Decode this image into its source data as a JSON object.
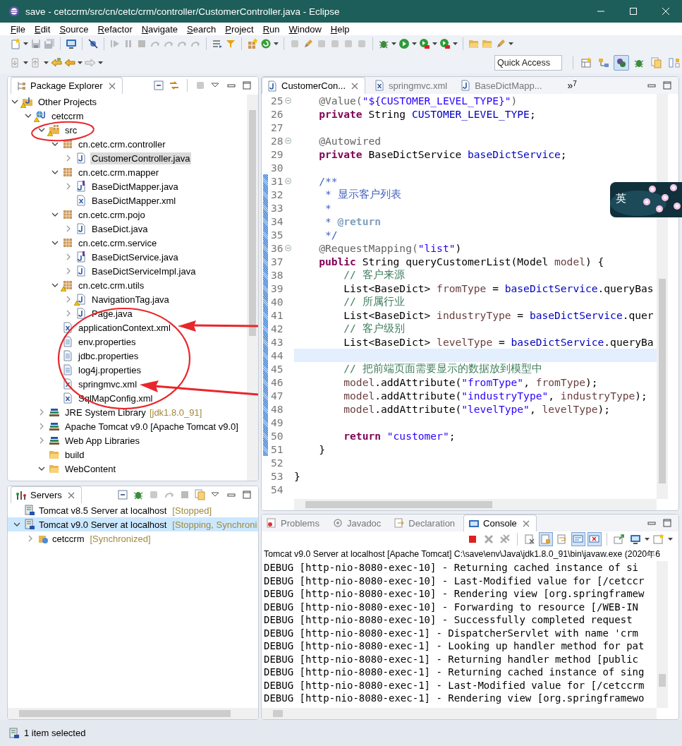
{
  "window": {
    "title": "save - cetccrm/src/cn/cetc/crm/controller/CustomerController.java - Eclipse"
  },
  "menu": [
    "File",
    "Edit",
    "Source",
    "Refactor",
    "Navigate",
    "Search",
    "Project",
    "Run",
    "Window",
    "Help"
  ],
  "quick_access": {
    "placeholder": "Quick Access"
  },
  "perspectives": [
    {
      "selected": false
    },
    {
      "selected": false
    },
    {
      "selected": true
    },
    {
      "selected": false
    },
    {
      "selected": false
    },
    {
      "selected": false
    }
  ],
  "package_explorer": {
    "title": "Package Explorer",
    "tree": [
      {
        "label": "Other Projects",
        "kind": "working-set",
        "expanded": true,
        "selected": false,
        "warning": true,
        "children": [
          {
            "label": "cetccrm",
            "kind": "project",
            "expanded": true,
            "selected": false,
            "warning": true,
            "children": [
              {
                "label": "src",
                "kind": "source-folder",
                "expanded": true,
                "selected": false,
                "warning": true,
                "children": [
                  {
                    "label": "cn.cetc.crm.controller",
                    "kind": "package",
                    "expanded": true,
                    "selected": false,
                    "warning": false,
                    "children": [
                      {
                        "label": "CustomerController.java",
                        "kind": "java",
                        "expanded": false,
                        "selected": true,
                        "warning": false
                      }
                    ]
                  },
                  {
                    "label": "cn.cetc.crm.mapper",
                    "kind": "package",
                    "expanded": true,
                    "selected": false,
                    "warning": false,
                    "children": [
                      {
                        "label": "BaseDictMapper.java",
                        "kind": "interface",
                        "expanded": false,
                        "selected": false,
                        "warning": false
                      },
                      {
                        "label": "BaseDictMapper.xml",
                        "kind": "xml",
                        "selected": false,
                        "warning": false
                      }
                    ]
                  },
                  {
                    "label": "cn.cetc.crm.pojo",
                    "kind": "package",
                    "expanded": true,
                    "selected": false,
                    "warning": false,
                    "children": [
                      {
                        "label": "BaseDict.java",
                        "kind": "java",
                        "expanded": false,
                        "selected": false,
                        "warning": false
                      }
                    ]
                  },
                  {
                    "label": "cn.cetc.crm.service",
                    "kind": "package",
                    "expanded": true,
                    "selected": false,
                    "warning": false,
                    "children": [
                      {
                        "label": "BaseDictService.java",
                        "kind": "interface",
                        "expanded": false,
                        "selected": false,
                        "warning": false
                      },
                      {
                        "label": "BaseDictServiceImpl.java",
                        "kind": "java",
                        "expanded": false,
                        "selected": false,
                        "warning": false
                      }
                    ]
                  },
                  {
                    "label": "cn.cetc.crm.utils",
                    "kind": "package",
                    "expanded": true,
                    "selected": false,
                    "warning": true,
                    "children": [
                      {
                        "label": "NavigationTag.java",
                        "kind": "java",
                        "expanded": false,
                        "selected": false,
                        "warning": true
                      },
                      {
                        "label": "Page.java",
                        "kind": "java",
                        "expanded": false,
                        "selected": false,
                        "warning": false
                      }
                    ]
                  },
                  {
                    "label": "applicationContext.xml",
                    "kind": "xml",
                    "selected": false,
                    "warning": false
                  },
                  {
                    "label": "env.properties",
                    "kind": "properties",
                    "selected": false,
                    "warning": false
                  },
                  {
                    "label": "jdbc.properties",
                    "kind": "properties",
                    "selected": false,
                    "warning": false
                  },
                  {
                    "label": "log4j.properties",
                    "kind": "properties",
                    "selected": false,
                    "warning": false
                  },
                  {
                    "label": "springmvc.xml",
                    "kind": "xml",
                    "selected": false,
                    "warning": false
                  },
                  {
                    "label": "SqlMapConfig.xml",
                    "kind": "xml",
                    "selected": false,
                    "warning": false
                  }
                ]
              },
              {
                "label": "JRE System Library",
                "decoration": "[jdk1.8.0_91]",
                "kind": "library",
                "expanded": false,
                "selected": false,
                "warning": false
              },
              {
                "label": "Apache Tomcat v9.0 [Apache Tomcat v9.0]",
                "kind": "library",
                "expanded": false,
                "selected": false,
                "warning": false
              },
              {
                "label": "Web App Libraries",
                "kind": "library",
                "expanded": false,
                "selected": false,
                "warning": false
              },
              {
                "label": "build",
                "kind": "folder",
                "selected": false,
                "warning": false
              },
              {
                "label": "WebContent",
                "kind": "folder",
                "expanded": true,
                "selected": false,
                "warning": false
              }
            ]
          }
        ]
      }
    ]
  },
  "editor": {
    "tabs": [
      {
        "label": "CustomerCon...",
        "kind": "java",
        "selected": true
      },
      {
        "label": "springmvc.xml",
        "kind": "xml",
        "selected": false
      },
      {
        "label": "BaseDictMapp...",
        "kind": "java",
        "selected": false
      }
    ],
    "overflow": {
      "symbol": "»",
      "count": "7"
    },
    "lines": [
      {
        "n": "25",
        "fold": true,
        "changed": false,
        "current": false,
        "tokens": [
          {
            "kind": "ann",
            "text": "    @Value("
          },
          {
            "kind": "str",
            "text": "\"${CUSTOMER_LEVEL_TYPE}\""
          },
          {
            "kind": "ann",
            "text": ")"
          }
        ]
      },
      {
        "n": "26",
        "fold": false,
        "changed": false,
        "current": false,
        "tokens": [
          {
            "kind": "kw",
            "text": "    private"
          },
          {
            "kind": "plain",
            "text": " String "
          },
          {
            "kind": "field",
            "text": "CUSTOMER_LEVEL_TYPE"
          },
          {
            "kind": "plain",
            "text": ";"
          }
        ]
      },
      {
        "n": "27",
        "fold": false,
        "changed": false,
        "current": false
      },
      {
        "n": "28",
        "fold": true,
        "changed": false,
        "current": false,
        "tokens": [
          {
            "kind": "ann",
            "text": "    @Autowired"
          }
        ]
      },
      {
        "n": "29",
        "fold": false,
        "changed": false,
        "current": false,
        "tokens": [
          {
            "kind": "kw",
            "text": "    private"
          },
          {
            "kind": "plain",
            "text": " BaseDictService "
          },
          {
            "kind": "field",
            "text": "baseDictService"
          },
          {
            "kind": "plain",
            "text": ";"
          }
        ]
      },
      {
        "n": "30",
        "fold": false,
        "changed": false,
        "current": false
      },
      {
        "n": "31",
        "fold": true,
        "changed": true,
        "current": false,
        "tokens": [
          {
            "kind": "doc",
            "text": "    /**"
          }
        ]
      },
      {
        "n": "32",
        "fold": false,
        "changed": true,
        "current": false,
        "tokens": [
          {
            "kind": "doc",
            "text": "     * 显示客户列表"
          }
        ]
      },
      {
        "n": "33",
        "fold": false,
        "changed": true,
        "current": false,
        "tokens": [
          {
            "kind": "doc",
            "text": "     *"
          }
        ]
      },
      {
        "n": "34",
        "fold": false,
        "changed": true,
        "current": false,
        "tokens": [
          {
            "kind": "doc",
            "text": "     * "
          },
          {
            "kind": "doctag",
            "text": "@return"
          }
        ]
      },
      {
        "n": "35",
        "fold": false,
        "changed": true,
        "current": false,
        "tokens": [
          {
            "kind": "doc",
            "text": "     */"
          }
        ]
      },
      {
        "n": "36",
        "fold": true,
        "changed": true,
        "current": false,
        "tokens": [
          {
            "kind": "ann",
            "text": "    @RequestMapping("
          },
          {
            "kind": "str",
            "text": "\"list\""
          },
          {
            "kind": "plain",
            "text": ")"
          }
        ]
      },
      {
        "n": "37",
        "fold": false,
        "changed": true,
        "current": false,
        "tokens": [
          {
            "kind": "kw",
            "text": "    public"
          },
          {
            "kind": "plain",
            "text": " String queryCustomerList(Model "
          },
          {
            "kind": "local",
            "text": "model"
          },
          {
            "kind": "plain",
            "text": ") {"
          }
        ]
      },
      {
        "n": "38",
        "fold": false,
        "changed": true,
        "current": false,
        "tokens": [
          {
            "kind": "comment",
            "text": "        // 客户来源"
          }
        ]
      },
      {
        "n": "39",
        "fold": false,
        "changed": true,
        "current": false,
        "tokens": [
          {
            "kind": "plain",
            "text": "        List<BaseDict> "
          },
          {
            "kind": "local",
            "text": "fromType"
          },
          {
            "kind": "plain",
            "text": " = "
          },
          {
            "kind": "field",
            "text": "baseDictService"
          },
          {
            "kind": "plain",
            "text": ".queryBas"
          }
        ]
      },
      {
        "n": "40",
        "fold": false,
        "changed": true,
        "current": false,
        "tokens": [
          {
            "kind": "comment",
            "text": "        // 所属行业"
          }
        ]
      },
      {
        "n": "41",
        "fold": false,
        "changed": true,
        "current": false,
        "tokens": [
          {
            "kind": "plain",
            "text": "        List<BaseDict> "
          },
          {
            "kind": "local",
            "text": "industryType"
          },
          {
            "kind": "plain",
            "text": " = "
          },
          {
            "kind": "field",
            "text": "baseDictService"
          },
          {
            "kind": "plain",
            "text": ".quer"
          }
        ]
      },
      {
        "n": "42",
        "fold": false,
        "changed": true,
        "current": false,
        "tokens": [
          {
            "kind": "comment",
            "text": "        // 客户级别"
          }
        ]
      },
      {
        "n": "43",
        "fold": false,
        "changed": true,
        "current": false,
        "tokens": [
          {
            "kind": "plain",
            "text": "        List<BaseDict> "
          },
          {
            "kind": "local",
            "text": "levelType"
          },
          {
            "kind": "plain",
            "text": " = "
          },
          {
            "kind": "field",
            "text": "baseDictService"
          },
          {
            "kind": "plain",
            "text": ".queryBa"
          }
        ]
      },
      {
        "n": "44",
        "fold": false,
        "changed": true,
        "current": true
      },
      {
        "n": "45",
        "fold": false,
        "changed": true,
        "current": false,
        "tokens": [
          {
            "kind": "comment",
            "text": "        // 把前端页面需要显示的数据放到模型中"
          }
        ]
      },
      {
        "n": "46",
        "fold": false,
        "changed": true,
        "current": false,
        "tokens": [
          {
            "kind": "local",
            "text": "        model"
          },
          {
            "kind": "plain",
            "text": ".addAttribute("
          },
          {
            "kind": "str",
            "text": "\"fromType\""
          },
          {
            "kind": "plain",
            "text": ", "
          },
          {
            "kind": "local",
            "text": "fromType"
          },
          {
            "kind": "plain",
            "text": ");"
          }
        ]
      },
      {
        "n": "47",
        "fold": false,
        "changed": true,
        "current": false,
        "tokens": [
          {
            "kind": "local",
            "text": "        model"
          },
          {
            "kind": "plain",
            "text": ".addAttribute("
          },
          {
            "kind": "str",
            "text": "\"industryType\""
          },
          {
            "kind": "plain",
            "text": ", "
          },
          {
            "kind": "local",
            "text": "industryType"
          },
          {
            "kind": "plain",
            "text": ");"
          }
        ]
      },
      {
        "n": "48",
        "fold": false,
        "changed": true,
        "current": false,
        "tokens": [
          {
            "kind": "local",
            "text": "        model"
          },
          {
            "kind": "plain",
            "text": ".addAttribute("
          },
          {
            "kind": "str",
            "text": "\"levelType\""
          },
          {
            "kind": "plain",
            "text": ", "
          },
          {
            "kind": "local",
            "text": "levelType"
          },
          {
            "kind": "plain",
            "text": ");"
          }
        ]
      },
      {
        "n": "49",
        "fold": false,
        "changed": true,
        "current": false
      },
      {
        "n": "50",
        "fold": false,
        "changed": true,
        "current": false,
        "tokens": [
          {
            "kind": "kw",
            "text": "        return"
          },
          {
            "kind": "str",
            "text": " \"customer\""
          },
          {
            "kind": "plain",
            "text": ";"
          }
        ]
      },
      {
        "n": "51",
        "fold": false,
        "changed": true,
        "current": false,
        "tokens": [
          {
            "kind": "plain",
            "text": "    }"
          }
        ]
      },
      {
        "n": "52",
        "fold": false,
        "changed": false,
        "current": false
      },
      {
        "n": "53",
        "fold": false,
        "changed": false,
        "current": false,
        "tokens": [
          {
            "kind": "plain",
            "text": "}"
          }
        ]
      },
      {
        "n": "54",
        "fold": false,
        "changed": false,
        "current": false
      }
    ]
  },
  "ime_indicator": {
    "label": "英"
  },
  "servers": {
    "title": "Servers",
    "items": [
      {
        "label": "Tomcat v8.5 Server at localhost",
        "state": "[Stopped]",
        "kind": "server",
        "selected": false
      },
      {
        "label": "Tomcat v9.0 Server at localhost",
        "state": "[Stopping, Synchroni",
        "kind": "server",
        "selected": true,
        "expanded": true,
        "children": [
          {
            "label": "cetccrm",
            "state": "[Synchronized]",
            "kind": "module",
            "selected": false,
            "expanded": false
          }
        ]
      }
    ]
  },
  "bottom_tabs": [
    {
      "label": "Problems",
      "kind": "problems",
      "selected": false
    },
    {
      "label": "Javadoc",
      "kind": "javadoc",
      "selected": false
    },
    {
      "label": "Declaration",
      "kind": "declaration",
      "selected": false
    },
    {
      "label": "Console",
      "kind": "console",
      "selected": true
    }
  ],
  "console": {
    "buttons": [
      {
        "pressed": false
      },
      {
        "pressed": false
      },
      {
        "pressed": false
      },
      {
        "pressed": false
      },
      {
        "pressed": true
      },
      {
        "pressed": false
      },
      {
        "pressed": true
      },
      {
        "pressed": true
      },
      {
        "pressed": false
      },
      {
        "pressed": false
      },
      {
        "pressed": false
      }
    ],
    "header": "Tomcat v9.0 Server at localhost [Apache Tomcat] C:\\save\\env\\Java\\jdk1.8.0_91\\bin\\javaw.exe (2020年6",
    "lines": [
      "DEBUG [http-nio-8080-exec-10] - Returning cached instance of si",
      "DEBUG [http-nio-8080-exec-10] - Last-Modified value for [/cetccr",
      "DEBUG [http-nio-8080-exec-10] - Rendering view [org.springframew",
      "DEBUG [http-nio-8080-exec-10] - Forwarding to resource [/WEB-IN",
      "DEBUG [http-nio-8080-exec-10] - Successfully completed request",
      "DEBUG [http-nio-8080-exec-1] - DispatcherServlet with name 'crm",
      "DEBUG [http-nio-8080-exec-1] - Looking up handler method for pat",
      "DEBUG [http-nio-8080-exec-1] - Returning handler method [public",
      "DEBUG [http-nio-8080-exec-1] - Returning cached instance of sing",
      "DEBUG [http-nio-8080-exec-1] - Last-Modified value for [/cetccrm",
      "DEBUG [http-nio-8080-exec-1] - Rendering view [org.springframewo"
    ]
  },
  "status_bar": {
    "text": "1 item selected"
  }
}
